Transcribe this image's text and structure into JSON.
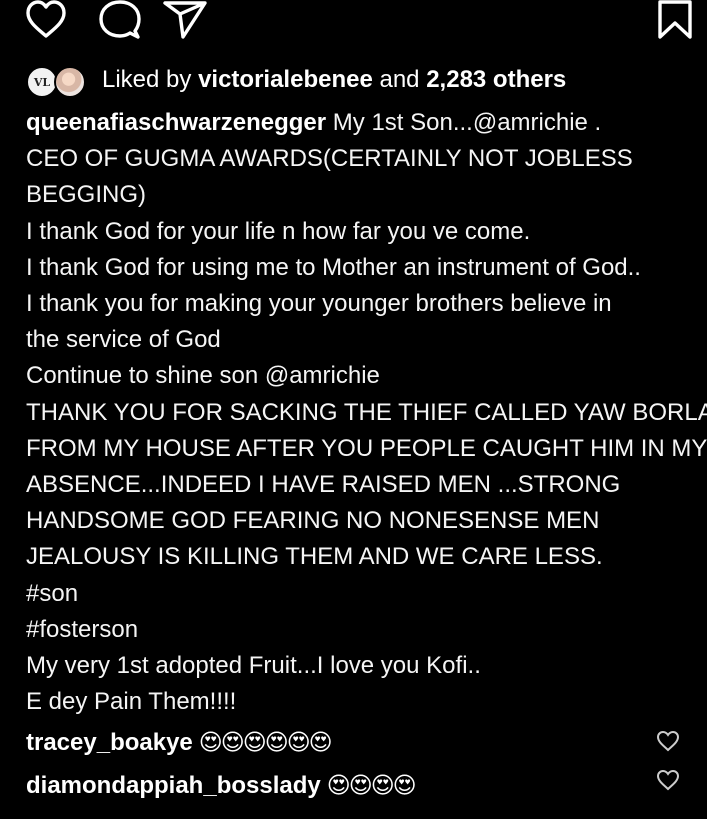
{
  "actions": {
    "like_icon": "heart-outline",
    "comment_icon": "speech-bubble",
    "share_icon": "paper-plane",
    "save_icon": "bookmark"
  },
  "likes": {
    "avatar1_initials": "VL",
    "prefix": "Liked by ",
    "user": "victorialebenee",
    "middle": " and ",
    "count": "2,283 others"
  },
  "caption": {
    "username": "queenafiaschwarzenegger",
    "first_line_rest": " My 1st Son...@amrichie .",
    "lines": [
      "CEO OF GUGMA AWARDS(CERTAINLY NOT JOBLESS",
      "BEGGING)",
      "I thank God for your life n how far you ve come.",
      "I thank God for using me to Mother an instrument of God..",
      "I thank you for making your younger brothers believe in",
      "the service of God",
      "Continue to shine son @amrichie",
      "THANK YOU FOR SACKING THE THIEF CALLED YAW BORLA",
      "FROM MY HOUSE AFTER YOU PEOPLE CAUGHT HIM IN MY",
      "ABSENCE...INDEED I HAVE RAISED MEN ...STRONG",
      "HANDSOME GOD FEARING NO NONESENSE MEN",
      "JEALOUSY IS KILLING THEM AND  WE CARE LESS.",
      "#son",
      "#fosterson",
      "My very 1st adopted Fruit...I love you Kofi..",
      "E dey Pain Them!!!!"
    ]
  },
  "comments": [
    {
      "username": "tracey_boakye",
      "emojis": "😍😍😍😍😍😍"
    },
    {
      "username": "diamondappiah_bosslady",
      "emojis": "😍😍😍😍"
    }
  ]
}
